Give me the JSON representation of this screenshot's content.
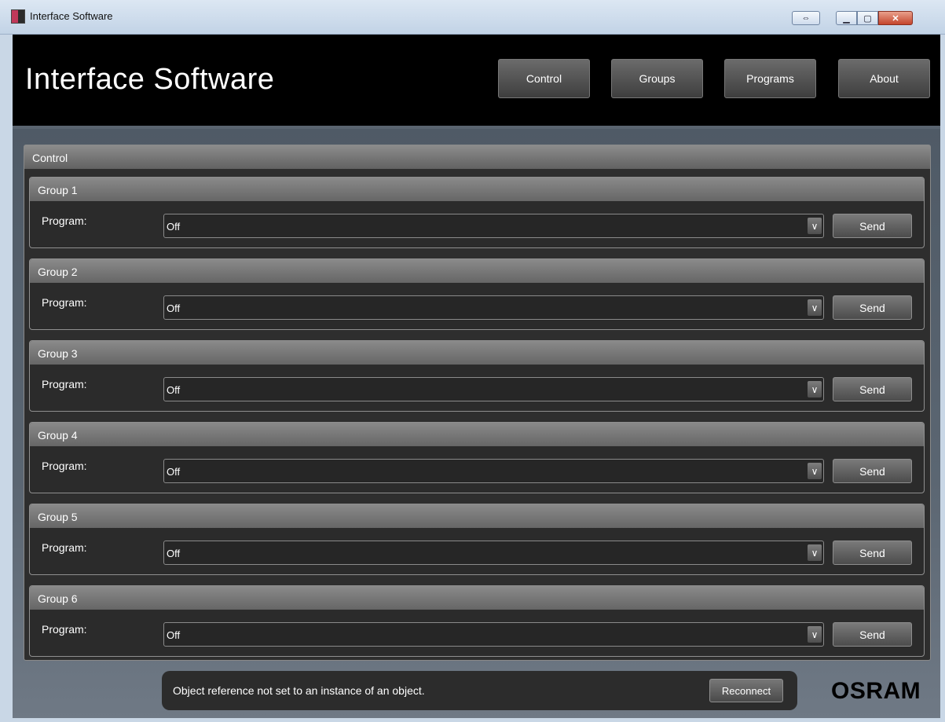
{
  "window": {
    "title": "Interface Software",
    "icons": {
      "app": "app-icon",
      "resize": "resize-arrows-icon",
      "minimize": "minimize-icon",
      "maximize": "maximize-icon",
      "close": "close-icon"
    }
  },
  "header": {
    "title": "Interface Software",
    "nav": [
      "Control",
      "Groups",
      "Programs",
      "About"
    ]
  },
  "control": {
    "title": "Control",
    "groups": [
      {
        "name": "Group 1",
        "program_label": "Program:",
        "program_value": "Off",
        "send_label": "Send"
      },
      {
        "name": "Group 2",
        "program_label": "Program:",
        "program_value": "Off",
        "send_label": "Send"
      },
      {
        "name": "Group 3",
        "program_label": "Program:",
        "program_value": "Off",
        "send_label": "Send"
      },
      {
        "name": "Group 4",
        "program_label": "Program:",
        "program_value": "Off",
        "send_label": "Send"
      },
      {
        "name": "Group 5",
        "program_label": "Program:",
        "program_value": "Off",
        "send_label": "Send"
      },
      {
        "name": "Group 6",
        "program_label": "Program:",
        "program_value": "Off",
        "send_label": "Send"
      }
    ]
  },
  "status": {
    "message": "Object reference not set to an instance of an object.",
    "reconnect_label": "Reconnect"
  },
  "brand": "OSRAM",
  "colors": {
    "header_bg": "#000000",
    "panel_bg": "#2e2e2e",
    "body_gradient_top": "#4f5a66"
  }
}
